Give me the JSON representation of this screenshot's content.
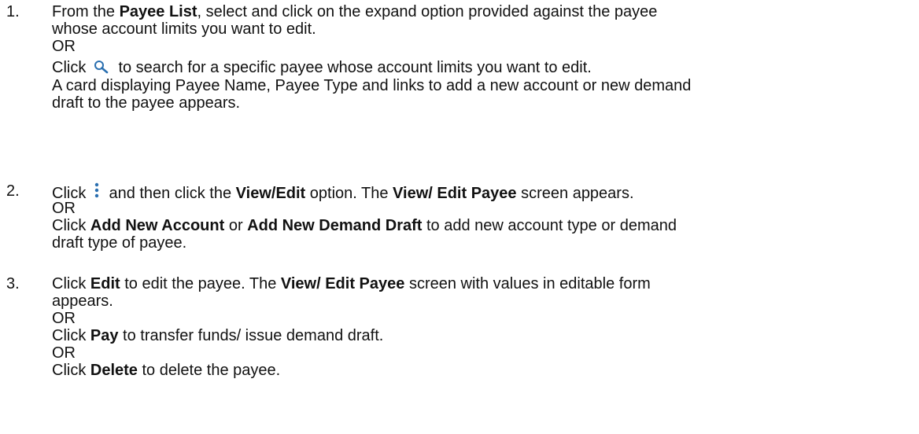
{
  "steps": [
    {
      "number": "1.",
      "lines": {
        "l1a": "From the ",
        "l1b": "Payee List",
        "l1c": ", select and click on the expand option provided against the payee",
        "l2": "whose account limits you want to edit.",
        "l3": "OR",
        "l4a": "Click ",
        "l4b": " to search for a specific payee whose account limits you want to edit.",
        "l5": "A card displaying Payee Name, Payee Type and links to add a new account or new demand",
        "l6": "draft to the payee appears."
      }
    },
    {
      "number": "2.",
      "lines": {
        "l1a": "Click ",
        "l1b": " and then click the ",
        "l1c": "View/Edit",
        "l1d": " option. The ",
        "l1e": "View/ Edit Payee",
        "l1f": " screen appears.",
        "l2": "OR",
        "l3a": "Click ",
        "l3b": "Add New Account",
        "l3c": " or ",
        "l3d": "Add New Demand Draft",
        "l3e": " to add new account type or demand",
        "l4": "draft type of payee."
      }
    },
    {
      "number": "3.",
      "lines": {
        "l1a": "Click ",
        "l1b": "Edit",
        "l1c": " to edit the payee. The ",
        "l1d": "View/ Edit Payee",
        "l1e": " screen with values in editable form",
        "l2": "appears.",
        "l3": "OR",
        "l4a": "Click ",
        "l4b": "Pay",
        "l4c": " to transfer funds/ issue demand draft.",
        "l5": "OR",
        "l6a": "Click ",
        "l6b": "Delete",
        "l6c": " to delete the payee."
      }
    }
  ],
  "icons": {
    "search": "search-icon",
    "more": "kebab-menu-icon",
    "color": "#2a6fb0"
  }
}
